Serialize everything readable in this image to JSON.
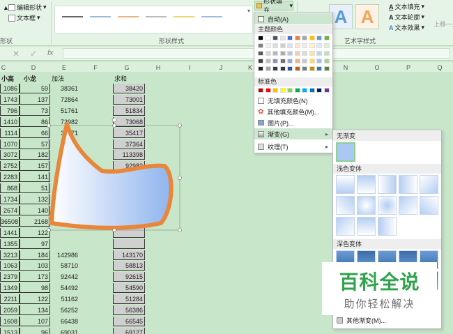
{
  "ribbon": {
    "edit_shape": "编辑形状",
    "text_box": "文本框",
    "shape_section": "形状",
    "shape_style_section": "形状样式",
    "art_section": "艺术字样式",
    "fill_btn": "形状填充",
    "text_fill": "文本填充",
    "text_outline": "文本轮廓",
    "text_effect": "文本效果",
    "move_up": "上移一层",
    "art_letter": "A"
  },
  "formula_bar": {
    "fx": "fx",
    "cancel": "✕",
    "confirm": "✓"
  },
  "columns": [
    "C",
    "D",
    "E",
    "F",
    "G",
    "H",
    "I",
    "J",
    "K",
    "N",
    "O",
    "P",
    "Q"
  ],
  "header_row": {
    "c": "小高",
    "d": "小龙",
    "e": "加法",
    "g": "求和"
  },
  "col_c": [
    "1086",
    "1743",
    "796",
    "1410",
    "1114",
    "1070",
    "3072",
    "2752",
    "2283",
    "868",
    "1734",
    "2674",
    "36508",
    "1441",
    "1355",
    "3213",
    "1063",
    "2379",
    "1349",
    "2211",
    "2059",
    "1608",
    "1513",
    "75301"
  ],
  "col_d": [
    "59",
    "137",
    "73",
    "86",
    "66",
    "57",
    "182",
    "157",
    "141",
    "51",
    "132",
    "140",
    "2168",
    "122",
    "97",
    "184",
    "103",
    "173",
    "98",
    "122",
    "134",
    "107",
    "96",
    "4685"
  ],
  "col_e_top": [
    "38361",
    "72864",
    "51761",
    "72982",
    "35171"
  ],
  "col_e_bottom": [
    "142986",
    "58710",
    "92442",
    "54492",
    "51162",
    "56252",
    "66438",
    "69031"
  ],
  "col_g_top": [
    "38420",
    "73001",
    "51834",
    "73068",
    "35417",
    "37364",
    "113398",
    "92983",
    "92174",
    "36"
  ],
  "col_g_bottom": [
    "143170",
    "58813",
    "92615",
    "54590",
    "51284",
    "56386",
    "66545",
    "69127"
  ],
  "menu": {
    "auto": "自动(A)",
    "theme_colors": "主题颜色",
    "standard_colors": "标准色",
    "no_fill": "无填充颜色(N)",
    "more_fill": "其他填充颜色(M)...",
    "picture": "图片(P)...",
    "gradient": "渐变(G)",
    "texture": "纹理(T)"
  },
  "submenu": {
    "no_gradient": "无渐变",
    "light_variants": "浅色变体",
    "dark_variants": "深色变体",
    "more_gradients": "其他渐变(M)..."
  },
  "watermark": {
    "title": "百科全说",
    "subtitle": "助你轻松解决"
  },
  "colors": {
    "accent_green": "#2ea34b",
    "shape_outline": "#e8873a",
    "grad_light": "#c9dcf6",
    "grad_dark": "#3a6ea8"
  }
}
